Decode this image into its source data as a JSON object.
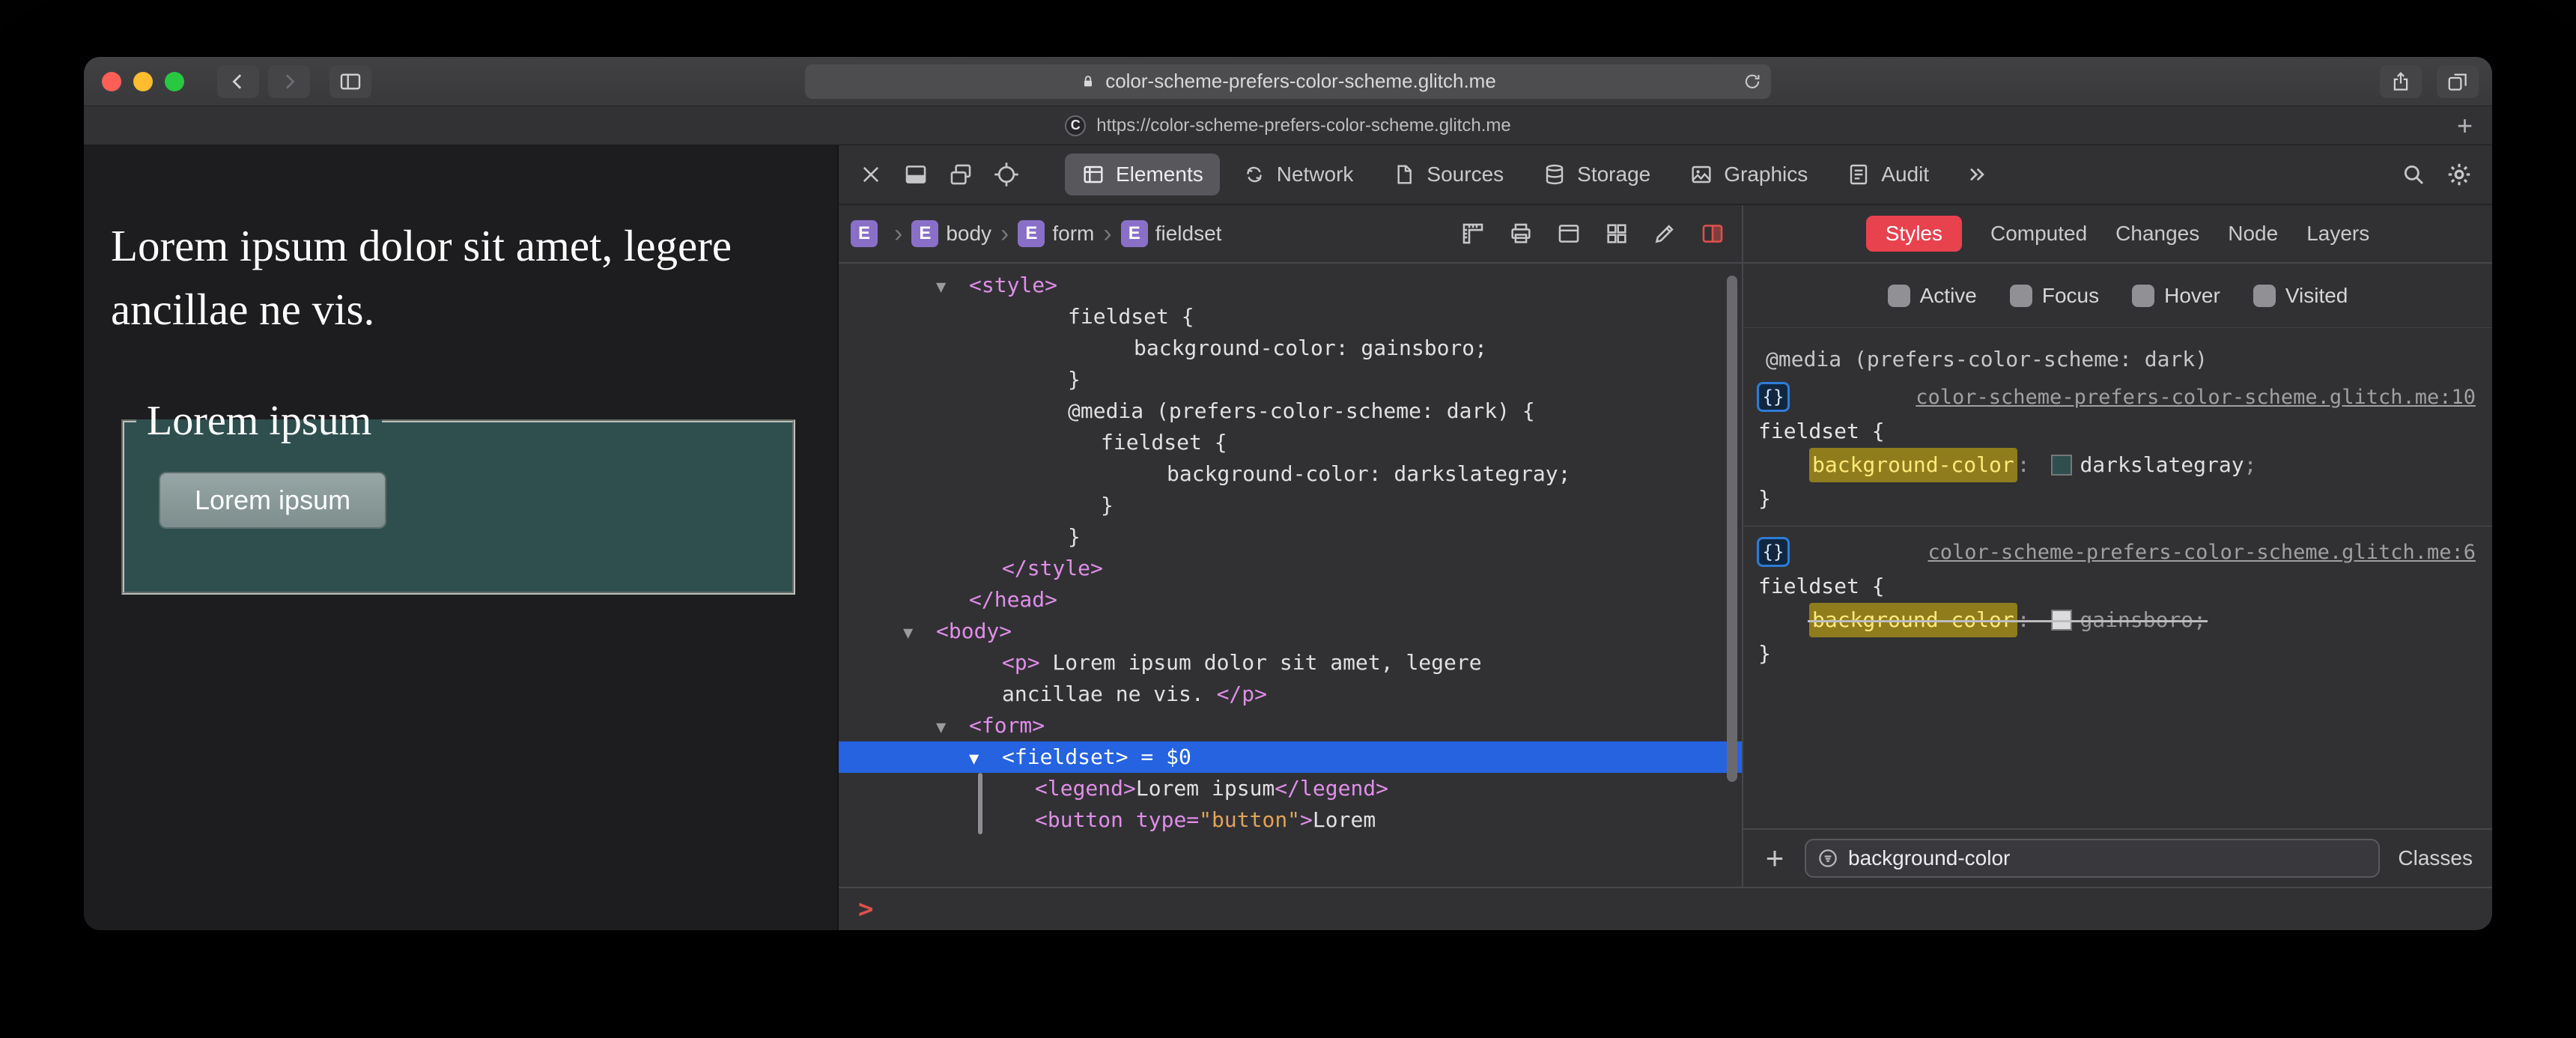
{
  "colors": {
    "accent_red": "#e8424f",
    "selection_blue": "#2563e0",
    "hl_bg": "#8f7d1d",
    "hl_text": "#ffe97a",
    "tag_pink": "#e08ee8",
    "attr_val_orange": "#e2a356",
    "badge_purple": "#8a6fc9",
    "console_red": "#e0504a",
    "traffic_red": "#ff5f57",
    "traffic_yellow": "#febc2e",
    "traffic_green": "#28c840",
    "fieldset_green": "#2f4f4f"
  },
  "browser": {
    "url": "color-scheme-prefers-color-scheme.glitch.me",
    "tab_url": "https://color-scheme-prefers-color-scheme.glitch.me",
    "favicon_letter": "C",
    "new_tab_label": "+"
  },
  "page": {
    "paragraph": "Lorem ipsum dolor sit amet, legere ancillae ne vis.",
    "legend": "Lorem ipsum",
    "button_label": "Lorem ipsum"
  },
  "inspector": {
    "toolbar_tabs": [
      {
        "label": "Elements"
      },
      {
        "label": "Network"
      },
      {
        "label": "Sources"
      },
      {
        "label": "Storage"
      },
      {
        "label": "Graphics"
      },
      {
        "label": "Audit"
      }
    ],
    "breadcrumb_separator": "›",
    "breadcrumbs": [
      {
        "badge": "E",
        "label": ""
      },
      {
        "badge": "E",
        "label": "body"
      },
      {
        "badge": "E",
        "label": "form"
      },
      {
        "badge": "E",
        "label": "fieldset"
      }
    ],
    "dom_tree": {
      "disclosure_glyph": "▼",
      "lines": [
        {
          "pad": 130,
          "arrow": true,
          "segments": [
            [
              "tag",
              "<style>"
            ]
          ]
        },
        {
          "pad": 306,
          "segments": [
            [
              "text",
              "fieldset {"
            ]
          ]
        },
        {
          "pad": 394,
          "segments": [
            [
              "text",
              "background-color: gainsboro;"
            ]
          ]
        },
        {
          "pad": 306,
          "segments": [
            [
              "text",
              "}"
            ]
          ]
        },
        {
          "pad": 306,
          "segments": [
            [
              "text",
              "@media (prefers-color-scheme: dark) {"
            ]
          ]
        },
        {
          "pad": 350,
          "segments": [
            [
              "text",
              "fieldset {"
            ]
          ]
        },
        {
          "pad": 438,
          "segments": [
            [
              "text",
              "background-color: darkslategray;"
            ]
          ]
        },
        {
          "pad": 350,
          "segments": [
            [
              "text",
              "}"
            ]
          ]
        },
        {
          "pad": 306,
          "segments": [
            [
              "text",
              "}"
            ]
          ]
        },
        {
          "pad": 218,
          "segments": [
            [
              "tag",
              "</style>"
            ]
          ]
        },
        {
          "pad": 174,
          "segments": [
            [
              "tag",
              "</head>"
            ]
          ]
        },
        {
          "pad": 86,
          "arrow": true,
          "segments": [
            [
              "tag",
              "<body>"
            ]
          ]
        },
        {
          "pad": 218,
          "segments": [
            [
              "tag",
              "<p>"
            ],
            [
              "text",
              " Lorem ipsum dolor sit amet, legere"
            ]
          ]
        },
        {
          "pad": 218,
          "segments": [
            [
              "text",
              "ancillae ne vis. "
            ],
            [
              "tag",
              "</p>"
            ]
          ]
        },
        {
          "pad": 130,
          "arrow": true,
          "segments": [
            [
              "tag",
              "<form>"
            ]
          ]
        },
        {
          "pad": 174,
          "arrow": true,
          "selected": true,
          "segments": [
            [
              "tag",
              "<fieldset>"
            ],
            [
              "text",
              " = $0"
            ]
          ]
        },
        {
          "pad": 262,
          "segments": [
            [
              "tag",
              "<legend>"
            ],
            [
              "text",
              "Lorem ipsum"
            ],
            [
              "tag",
              "</legend>"
            ]
          ]
        },
        {
          "pad": 262,
          "segments": [
            [
              "tag",
              "<button"
            ],
            [
              "text",
              " "
            ],
            [
              "attr",
              "type="
            ],
            [
              "val",
              "\"button\""
            ],
            [
              "tag",
              ">"
            ],
            [
              "text",
              "Lorem"
            ]
          ]
        }
      ]
    },
    "styles_panel": {
      "tabs": [
        {
          "label": "Styles"
        },
        {
          "label": "Computed"
        },
        {
          "label": "Changes"
        },
        {
          "label": "Node"
        },
        {
          "label": "Layers"
        }
      ],
      "pseudo": [
        {
          "label": "Active"
        },
        {
          "label": "Focus"
        },
        {
          "label": "Hover"
        },
        {
          "label": "Visited"
        }
      ],
      "sections": [
        {
          "media": "@media (prefers-color-scheme: dark)",
          "badge": "{}",
          "origin": "color-scheme-prefers-color-scheme.glitch.me:10",
          "selector": "fieldset {",
          "property": {
            "name": "background-color",
            "colon": ": ",
            "value": "darkslategray",
            "semicolon": ";",
            "swatch": "#2f4f4f"
          },
          "close": "}"
        },
        {
          "badge": "{}",
          "origin": "color-scheme-prefers-color-scheme.glitch.me:6",
          "selector": "fieldset {",
          "property": {
            "name": "background-color",
            "colon": ": ",
            "value": "gainsboro",
            "semicolon": ";",
            "swatch": "#dcdcdc"
          },
          "close": "}"
        }
      ],
      "filter_bar": {
        "add_label": "+",
        "value": "background-color",
        "classes_label": "Classes"
      }
    },
    "console_prompt": ">"
  }
}
